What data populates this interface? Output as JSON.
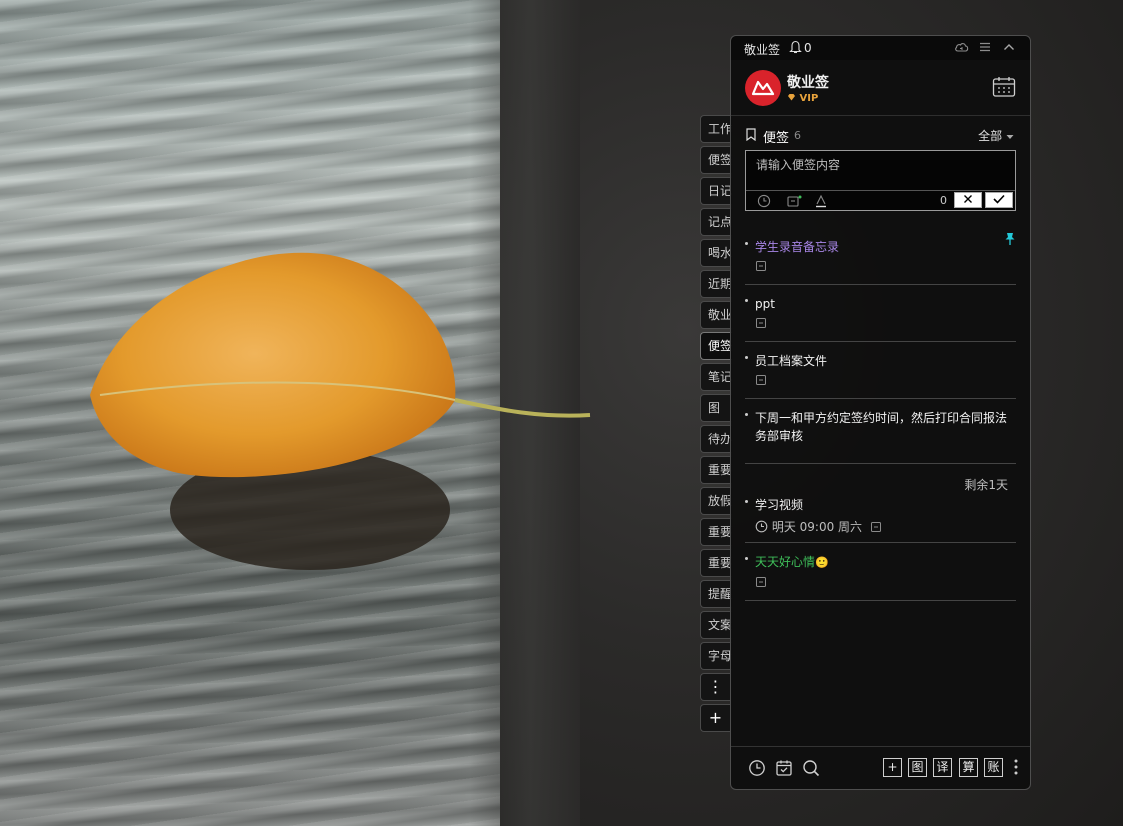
{
  "titlebar": {
    "app_name": "敬业签",
    "notification_count": "0"
  },
  "user": {
    "name": "敬业签",
    "badge": "VIP"
  },
  "notes_header": {
    "title": "便签",
    "count": "6",
    "filter": "全部"
  },
  "editor": {
    "placeholder": "请输入便签内容",
    "char_count": "0"
  },
  "side_tabs": [
    {
      "label": "工作"
    },
    {
      "label": "便签"
    },
    {
      "label": "日记"
    },
    {
      "label": "记点"
    },
    {
      "label": "喝水"
    },
    {
      "label": "近期"
    },
    {
      "label": "敬业"
    },
    {
      "label": "便签"
    },
    {
      "label": "笔记"
    },
    {
      "label": "图"
    },
    {
      "label": "待办"
    },
    {
      "label": "重要"
    },
    {
      "label": "放假"
    },
    {
      "label": "重要"
    },
    {
      "label": "重要"
    },
    {
      "label": "提醒"
    },
    {
      "label": "文案"
    },
    {
      "label": "字母"
    }
  ],
  "side_tab_more": "⋮",
  "side_tab_add": "+",
  "notes": [
    {
      "text": "学生录音备忘录",
      "color": "#a886e6",
      "pinned": true
    },
    {
      "text": "ppt",
      "color": "#f2f2f2"
    },
    {
      "text": "员工档案文件",
      "color": "#f2f2f2"
    },
    {
      "text": "下周一和甲方约定签约时间，然后打印合同报法务部审核",
      "color": "#f2f2f2"
    },
    {
      "text": "学习视频",
      "color": "#f2f2f2",
      "deadline": "剩余1天",
      "reminder": "明天 09:00 周六"
    },
    {
      "text": "天天好心情",
      "color": "#3fbf5a",
      "emoji": "🙂"
    }
  ],
  "bottom_tools": {
    "add": "+",
    "image": "图",
    "translate": "译",
    "calc": "算",
    "ledger": "账"
  },
  "colors": {
    "accent_red": "#d9232b",
    "vip_gold": "#e8a33c",
    "pin": "#23c9d9"
  }
}
